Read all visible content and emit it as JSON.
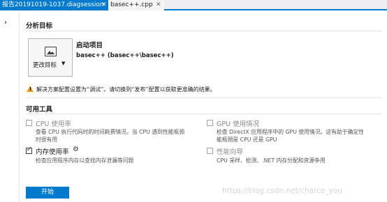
{
  "tabs": [
    {
      "label": "报告20191019-1037.diagsession",
      "close": "✕"
    },
    {
      "label": "basec++.cpp",
      "close": "✕"
    }
  ],
  "gutter": {
    "arrow": "›"
  },
  "analysis_target": {
    "title": "分析目标",
    "change_target_label": "更改目标",
    "change_target_caret": "▼",
    "startup_title": "启动项目",
    "startup_project": "basec++ (basec++\\basec++)"
  },
  "warning": {
    "icon": "warning-icon",
    "text": "解决方案配置设置为“调试”。请切换到“发布”配置以获取更准确的结果。"
  },
  "available_tools": {
    "title": "可用工具",
    "tools": [
      {
        "name": "CPU 使用率",
        "checked": false,
        "enabled": false,
        "desc_line1": "查看 CPU 执行代码时的时间耗费情况。当 CPU 遇到性能瓶颈",
        "desc_line2": "时很有用"
      },
      {
        "name": "GPU 使用情况",
        "checked": false,
        "enabled": false,
        "desc_line1": "检查 DirectX 应用程序中的 GPU 使用情况。这有助于确定性",
        "desc_line2": "能瓶颈是 CPU 还是 GPU"
      },
      {
        "name": "内存使用率",
        "checked": true,
        "enabled": true,
        "desc_line1": "检查应用程序内存以查找内存泄漏等问题",
        "desc_line2": ""
      },
      {
        "name": "性能向导",
        "checked": false,
        "enabled": false,
        "desc_line1": "CPU 采样、检测、.NET 内存分配和资源争用",
        "desc_line2": ""
      }
    ]
  },
  "start_button": "开始",
  "watermark": "https://blog.csdn.net/charce_you",
  "colors": {
    "accent": "#007acc",
    "warning": "#e8a317"
  }
}
